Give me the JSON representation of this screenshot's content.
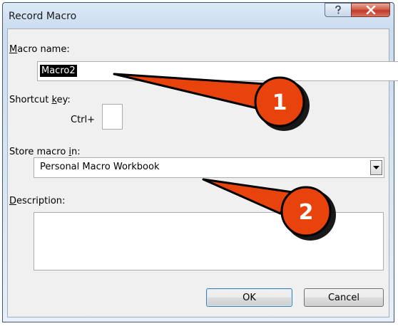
{
  "window": {
    "title": "Record Macro"
  },
  "labels": {
    "macro_name": {
      "before": "",
      "mnemonic": "M",
      "after": "acro name:"
    },
    "shortcut_key": {
      "before": "Shortcut ",
      "mnemonic": "k",
      "after": "ey:"
    },
    "ctrl": "Ctrl+",
    "store_in": {
      "before": "Store macro ",
      "mnemonic": "i",
      "after": "n:"
    },
    "description": {
      "before": "",
      "mnemonic": "D",
      "after": "escription:"
    }
  },
  "fields": {
    "macro_name": "Macro2",
    "shortcut_key": "",
    "store_in": "Personal Macro Workbook",
    "description": ""
  },
  "buttons": {
    "ok": "OK",
    "cancel": "Cancel"
  },
  "callouts": [
    {
      "label": "1"
    },
    {
      "label": "2"
    }
  ],
  "colors": {
    "callout_fill": "#e8430c",
    "callout_outline": "#000000",
    "close_button": "#c0392b"
  }
}
